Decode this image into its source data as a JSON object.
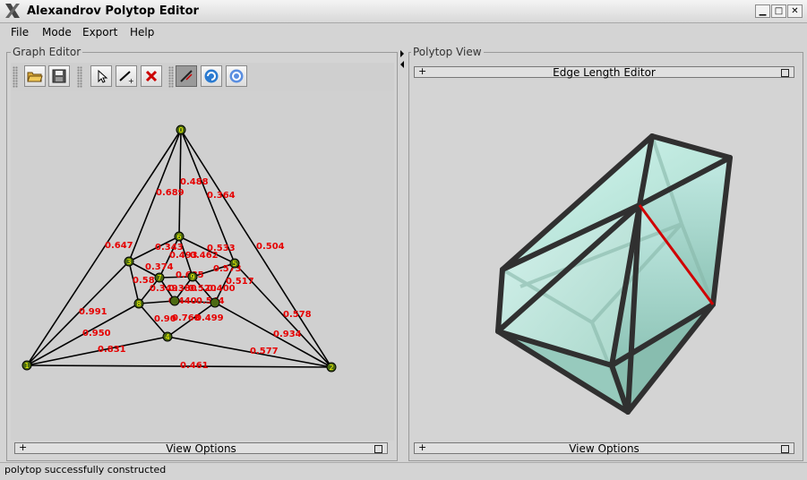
{
  "window": {
    "title": "Alexandrov Polytop Editor",
    "minimize": "▁",
    "maximize": "□",
    "close": "✕"
  },
  "menu": [
    "File",
    "Mode",
    "Export",
    "Help"
  ],
  "graph_editor": {
    "title": "Graph Editor",
    "toolbar_icons": [
      "open-icon",
      "save-icon",
      "select-pointer-icon",
      "add-edge-icon",
      "delete-icon",
      "edge-length-icon",
      "refresh-icon",
      "construct-icon"
    ],
    "view_options": "View Options",
    "edge_labels": [
      "0.488",
      "0.689",
      "0.364",
      "0.647",
      "0.343",
      "0.533",
      "0.504",
      "0.462",
      "0.493",
      "0.374",
      "0.685",
      "0.573",
      "0.58",
      "0.517",
      "0.349",
      "0.380",
      "0.520",
      "0.400",
      "0.440",
      "0.544",
      "0.991",
      "0.90",
      "0.768",
      "0.499",
      "0.950",
      "0.578",
      "0.934",
      "0.831",
      "0.577",
      "0.461"
    ],
    "vertex_labels": [
      "0",
      "1",
      "2",
      "3",
      "4",
      "5",
      "6",
      "7",
      "8",
      "9"
    ],
    "edge_label_color": "#e60000",
    "vertex_color": "#4c6a12",
    "vertex_label_color": "#ffff00"
  },
  "polytop_view": {
    "title": "Polytop View",
    "edge_length_editor": "Edge Length Editor",
    "view_options": "View Options",
    "face_color": "#bfeee6",
    "edge_color": "#303030",
    "highlight_edge_color": "#d00000"
  },
  "status": "polytop successfully constructed"
}
